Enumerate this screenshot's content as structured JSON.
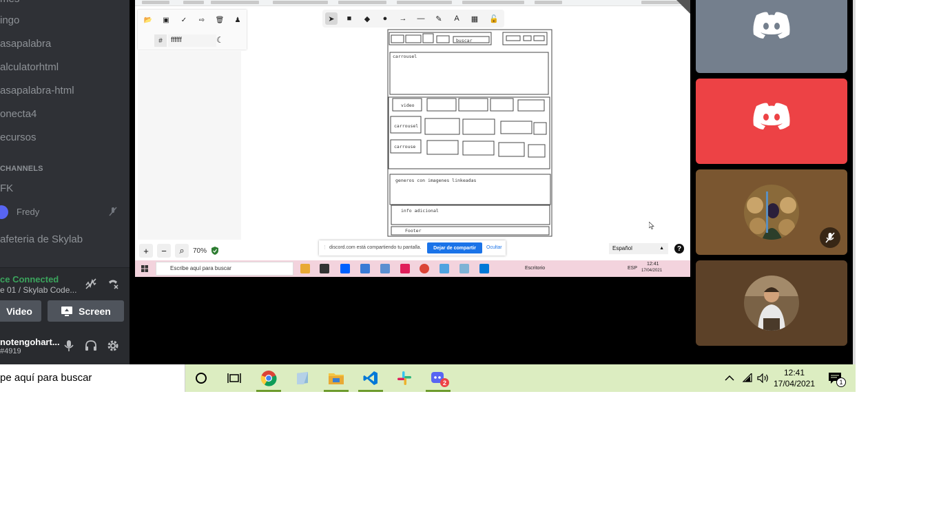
{
  "sidebar": {
    "channels": [
      "ingo",
      "asapalabra",
      "alculatorhtml",
      "asapalabra-html",
      "onecta4",
      "ecursos"
    ],
    "category": "CHANNELS",
    "voice_channels": [
      "FK",
      "afeteria de Skylab"
    ],
    "voice_user": "Fredy"
  },
  "voice_panel": {
    "status": "ce Connected",
    "channel": "e 01 / Skylab Code...",
    "video_label": "Video",
    "screen_label": "Screen"
  },
  "user": {
    "name": "notengohart...",
    "tag": "#4919"
  },
  "shared_screen": {
    "hex_value": "ffffff",
    "hash": "#",
    "wireframe": {
      "search_label": "buscar",
      "carousel_main": "carrousel",
      "video_label": "video",
      "carousel_2": "carrousel",
      "carousel_3": "carrouse",
      "genres": "generos con imagenes linkeadas",
      "info": "info adicional",
      "footer": "Footer"
    },
    "zoom": "70%",
    "share_message": "discord.com está compartiendo tu pantalla.",
    "stop_label": "Dejar de compartir",
    "hide_label": "Ocultar",
    "language": "Español",
    "taskbar": {
      "search": "Escribe aquí para buscar",
      "desktop": "Escritorio",
      "lang": "ESP",
      "time": "12:41",
      "date": "17/04/2021"
    }
  },
  "tiles": [
    {
      "bg": "#747f8d",
      "kind": "discord-logo"
    },
    {
      "bg": "#ed4245",
      "kind": "discord-logo"
    },
    {
      "bg": "#7a5630",
      "kind": "avatar",
      "muted": true
    },
    {
      "bg": "#5c4128",
      "kind": "avatar"
    }
  ],
  "taskbar": {
    "search_text": "pe aquí para buscar",
    "time": "12:41",
    "date": "17/04/2021",
    "notification_count": "1",
    "discord_badge": "2"
  },
  "colors": {
    "discord_bg": "#2f3136",
    "connected_green": "#3ba55d",
    "blurple": "#5865f2",
    "taskbar_bg": "#dcedc1"
  }
}
